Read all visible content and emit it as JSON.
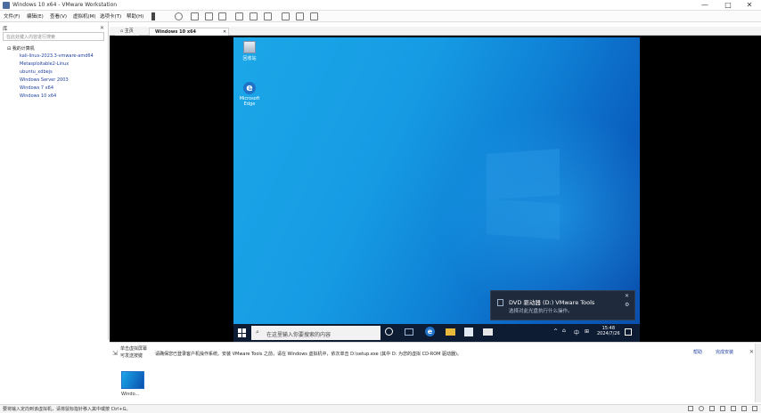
{
  "window": {
    "title": "Windows 10 x64 - VMware Workstation",
    "controls": [
      "—",
      "□",
      "✕"
    ]
  },
  "menu": {
    "items": [
      "文件(F)",
      "编辑(E)",
      "查看(V)",
      "虚拟机(M)",
      "选项卡(T)",
      "帮助(H)"
    ]
  },
  "sidebar": {
    "header": "库",
    "search_placeholder": "在此处键入内容进行搜索",
    "root_label": "我的计算机",
    "items": [
      "kali-linux-2023.3-vmware-amd64",
      "Metasploitable2-Linux",
      "ubuntu_xdbejs",
      "Windows Server 2003",
      "Windows 7 x64",
      "Windows 10 x64"
    ]
  },
  "tabs": {
    "home": "主页",
    "vm": "Windows 10 x64"
  },
  "desktop": {
    "icons": [
      {
        "name": "回收站"
      },
      {
        "name": "Microsoft Edge"
      }
    ]
  },
  "taskbar": {
    "search_placeholder": "在这里输入你要搜索的内容",
    "time": "15:48",
    "date": "2024/7/26",
    "lang": "中"
  },
  "toast": {
    "title": "DVD 驱动器 (D:) VMware Tools",
    "body": "选择对此光盘执行什么操作。"
  },
  "hint": {
    "left_line1": "单击虚拟屏幕",
    "left_line2": "可发送按键",
    "message": "请确保您已登录客户机操作系统。安装 VMware Tools 之前，请在 Windows 虚拟机中，依次单击 D:\\setup.exe (其中 D: 为您的虚拟 CD-ROM 驱动器)。",
    "right_btn1": "帮助",
    "right_btn2": "完成安装"
  },
  "thumbnail": {
    "label": "Windo..."
  },
  "status": {
    "text": "要将输入定向到该虚拟机，请将鼠标指针移入其中或按 Ctrl+G。"
  },
  "colors": {
    "desktop_light": "#1ba7e8",
    "desktop_dark": "#0a50ae",
    "taskbar": "#0d1b33",
    "accent": "#1f6fc8"
  }
}
